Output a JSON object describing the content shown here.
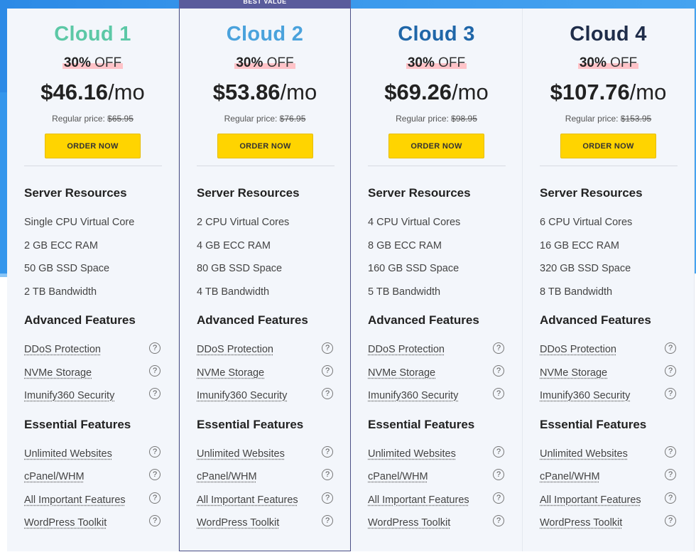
{
  "best_value_label": "BEST VALUE",
  "section_titles": {
    "server": "Server Resources",
    "advanced": "Advanced Features",
    "essential": "Essential Features"
  },
  "advanced_features": [
    "DDoS Protection",
    "NVMe Storage",
    "Imunify360 Security"
  ],
  "essential_features": [
    "Unlimited Websites",
    "cPanel/WHM",
    "All Important Features",
    "WordPress Toolkit"
  ],
  "help_icon_glyph": "?",
  "colors": {
    "button": "#ffd400",
    "featured_border": "#4b4f86",
    "discount_highlight": "#ffc3c8"
  },
  "plans": [
    {
      "name": "Cloud 1",
      "name_color": "#5cc8a6",
      "discount_pct": "30%",
      "discount_word": "OFF",
      "price": "$46.16",
      "period": "/mo",
      "regular_label": "Regular price:",
      "regular_price": "$65.95",
      "order_label": "ORDER NOW",
      "resources": [
        "Single CPU Virtual Core",
        "2 GB ECC RAM",
        "50 GB SSD Space",
        "2 TB Bandwidth"
      ]
    },
    {
      "name": "Cloud 2",
      "name_color": "#4aa2dc",
      "discount_pct": "30%",
      "discount_word": "OFF",
      "price": "$53.86",
      "period": "/mo",
      "regular_label": "Regular price:",
      "regular_price": "$76.95",
      "order_label": "ORDER NOW",
      "resources": [
        "2 CPU Virtual Cores",
        "4 GB ECC RAM",
        "80 GB SSD Space",
        "4 TB Bandwidth"
      ]
    },
    {
      "name": "Cloud 3",
      "name_color": "#1f66a8",
      "discount_pct": "30%",
      "discount_word": "OFF",
      "price": "$69.26",
      "period": "/mo",
      "regular_label": "Regular price:",
      "regular_price": "$98.95",
      "order_label": "ORDER NOW",
      "resources": [
        "4 CPU Virtual Cores",
        "8 GB ECC RAM",
        "160 GB SSD Space",
        "5 TB Bandwidth"
      ]
    },
    {
      "name": "Cloud 4",
      "name_color": "#1f2d4a",
      "discount_pct": "30%",
      "discount_word": "OFF",
      "price": "$107.76",
      "period": "/mo",
      "regular_label": "Regular price:",
      "regular_price": "$153.95",
      "order_label": "ORDER NOW",
      "resources": [
        "6 CPU Virtual Cores",
        "16 GB ECC RAM",
        "320 GB SSD Space",
        "8 TB Bandwidth"
      ]
    }
  ]
}
